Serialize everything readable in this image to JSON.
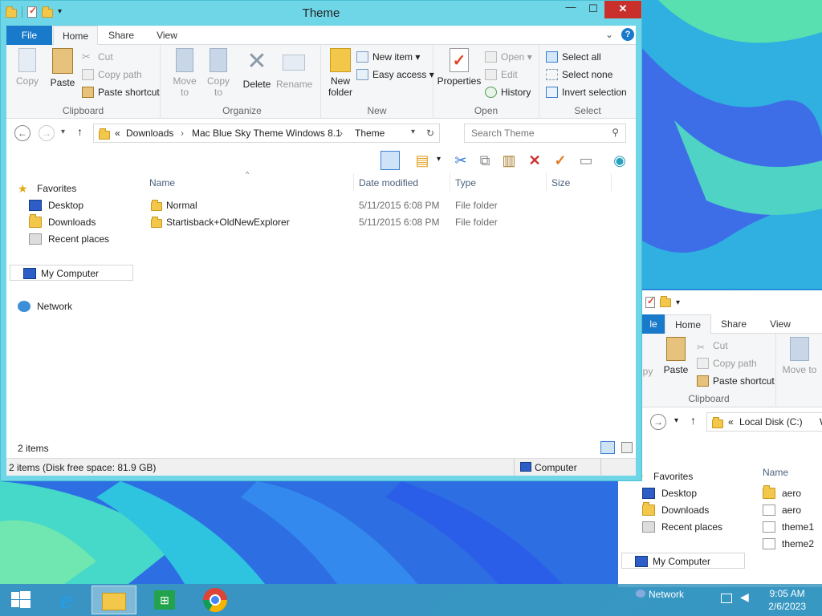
{
  "main_window": {
    "title": "Theme",
    "ribbon_tabs": [
      "File",
      "Home",
      "Share",
      "View"
    ],
    "clipboard": {
      "label": "Clipboard",
      "copy": "Copy",
      "paste": "Paste",
      "cut": "Cut",
      "copy_path": "Copy path",
      "paste_shortcut": "Paste shortcut"
    },
    "organize": {
      "label": "Organize",
      "move_to": "Move to",
      "copy_to": "Copy to",
      "delete": "Delete",
      "rename": "Rename"
    },
    "new": {
      "label": "New",
      "new_folder": "New folder",
      "new_item": "New item",
      "easy_access": "Easy access"
    },
    "open": {
      "label": "Open",
      "properties": "Properties",
      "open": "Open",
      "edit": "Edit",
      "history": "History"
    },
    "select": {
      "label": "Select",
      "select_all": "Select all",
      "select_none": "Select none",
      "invert_selection": "Invert selection"
    },
    "address": {
      "prefix": "«",
      "crumbs": [
        "Downloads",
        "Mac Blue Sky Theme Windows 8.1",
        "Theme"
      ]
    },
    "search_placeholder": "Search Theme",
    "nav": {
      "favorites": "Favorites",
      "desktop": "Desktop",
      "downloads": "Downloads",
      "recent_places": "Recent places",
      "my_computer": "My Computer",
      "network": "Network"
    },
    "columns": [
      "Name",
      "Date modified",
      "Type",
      "Size"
    ],
    "files": [
      {
        "name": "Normal",
        "date": "5/11/2015 6:08 PM",
        "type": "File folder"
      },
      {
        "name": "Startisback+OldNewExplorer",
        "date": "5/11/2015 6:08 PM",
        "type": "File folder"
      }
    ],
    "item_count": "2 items",
    "status_text": "2 items (Disk free space: 81.9 GB)",
    "status_location": "Computer"
  },
  "back_window": {
    "ribbon_tabs": [
      "le",
      "Home",
      "Share",
      "View"
    ],
    "paste": "Paste",
    "cut": "Cut",
    "copy_path": "Copy path",
    "paste_shortcut": "Paste shortcut",
    "move_to": "Move to",
    "clipboard_label": "Clipboard",
    "copy_partial": "py",
    "address_prefix": "«",
    "address_crumb": "Local Disk (C:)",
    "address_tail": "W",
    "nav": {
      "favorites": "Favorites",
      "desktop": "Desktop",
      "downloads": "Downloads",
      "recent_places": "Recent places",
      "my_computer": "My Computer",
      "network": "Network"
    },
    "column_name": "Name",
    "files": [
      "aero",
      "aero",
      "theme1",
      "theme2"
    ]
  },
  "taskbar": {
    "time": "9:05 AM",
    "date": "2/6/2023"
  },
  "colors": {
    "accent": "#1979ca",
    "window_frame": "#6fd6e8",
    "close": "#c9302c"
  }
}
